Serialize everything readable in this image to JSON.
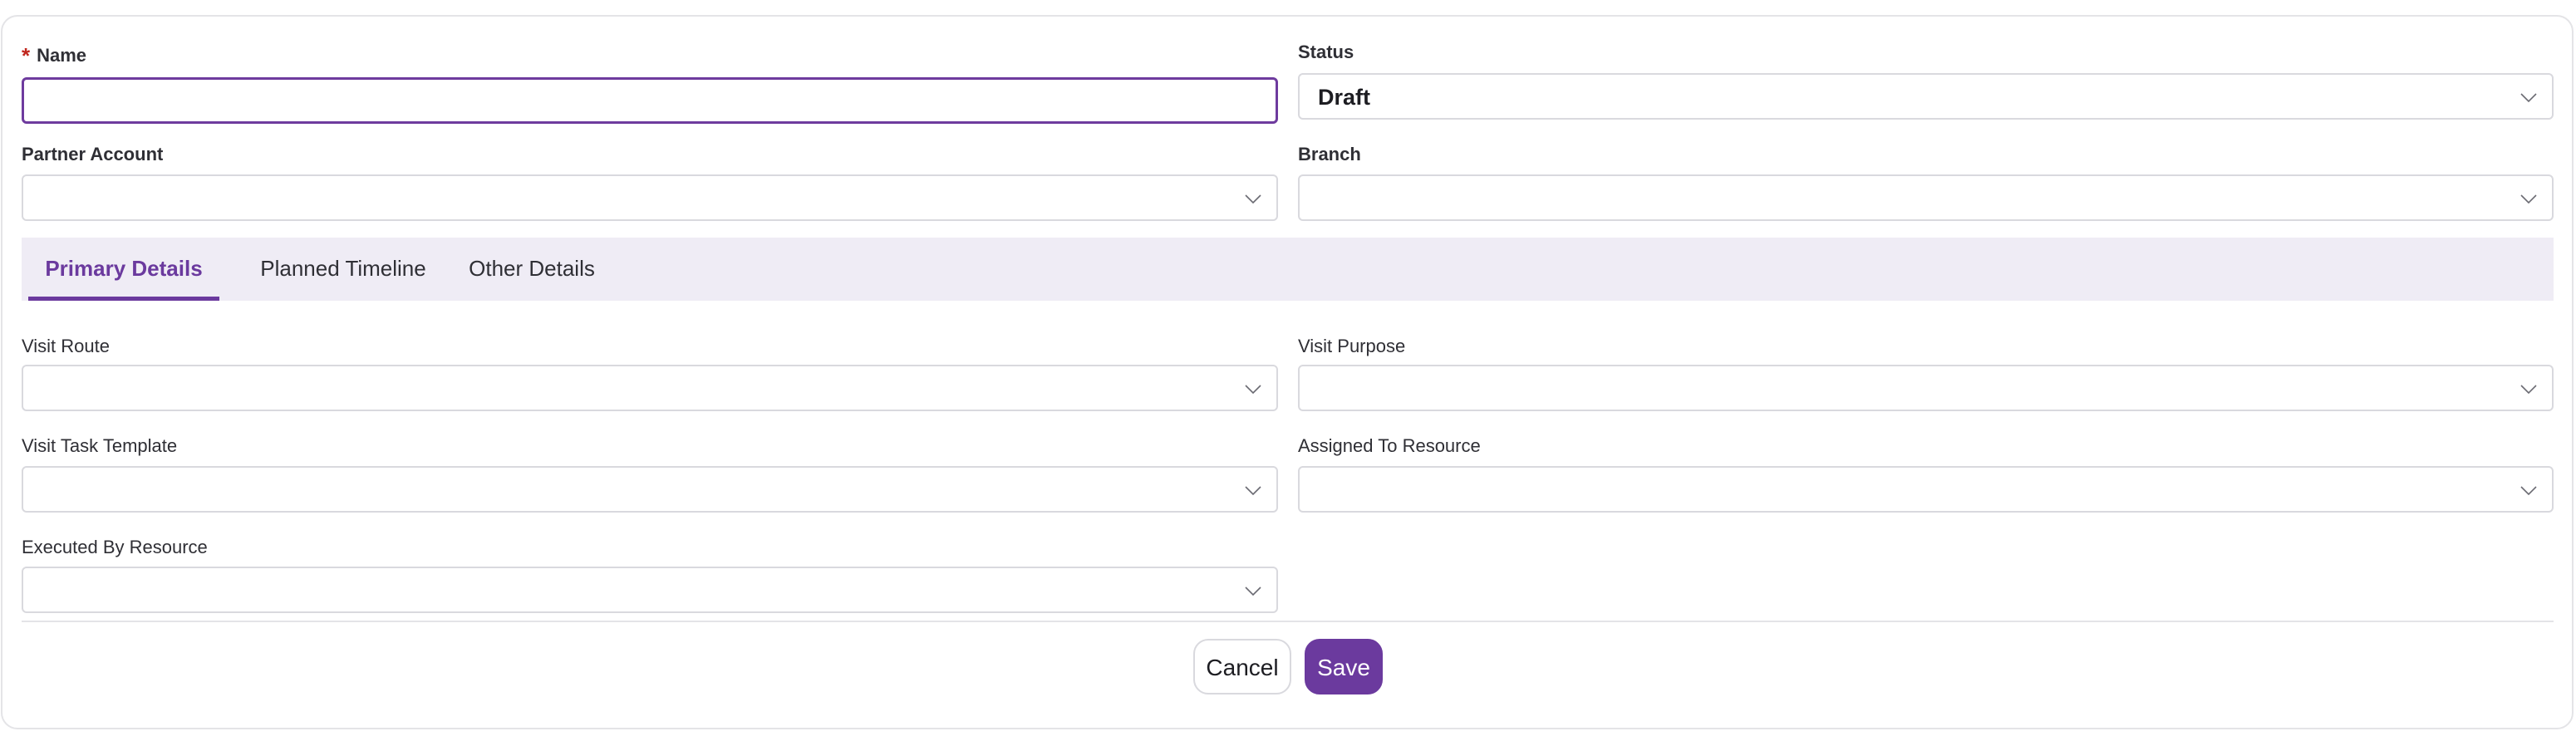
{
  "form": {
    "name_label": "Name",
    "name_required_mark": "*",
    "name_value": "",
    "status_label": "Status",
    "status_value": "Draft",
    "partner_account_label": "Partner Account",
    "branch_label": "Branch"
  },
  "tabs": [
    {
      "label": "Primary Details",
      "active": true
    },
    {
      "label": "Planned Timeline",
      "active": false
    },
    {
      "label": "Other Details",
      "active": false
    }
  ],
  "primary_details": {
    "visit_route_label": "Visit Route",
    "visit_purpose_label": "Visit Purpose",
    "visit_task_template_label": "Visit Task Template",
    "assigned_to_resource_label": "Assigned To Resource",
    "executed_by_resource_label": "Executed By Resource"
  },
  "actions": {
    "cancel_label": "Cancel",
    "save_label": "Save"
  },
  "colors": {
    "accent": "#6b3a9e",
    "tab_bar_bg": "#efecf5",
    "required": "#c0271e",
    "border": "#d9d9de"
  },
  "icons": {
    "dropdown": "chevron-down-icon"
  }
}
